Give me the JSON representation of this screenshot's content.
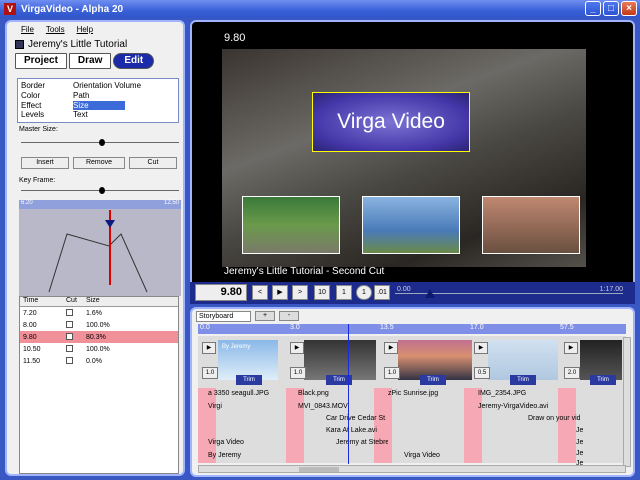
{
  "window": {
    "title": "VirgaVideo - Alpha 20",
    "icon_letter": "V",
    "buttons": [
      "_",
      "□",
      "×"
    ]
  },
  "menu": {
    "items": [
      "File",
      "Tools",
      "Help"
    ]
  },
  "document": {
    "title": "Jeremy's Little Tutorial"
  },
  "mode_tabs": [
    {
      "label": "Project"
    },
    {
      "label": "Draw"
    },
    {
      "label": "Edit",
      "active": true
    }
  ],
  "properties": {
    "col1": [
      "Border",
      "Color",
      "Effect",
      "Levels"
    ],
    "col2": [
      "Orientation  Volume",
      "Path",
      "Size",
      "Text"
    ],
    "selected": "Size"
  },
  "master_size": {
    "label": "Master Size:",
    "value": 0.5
  },
  "actions": [
    "Insert",
    "Remove",
    "Cut"
  ],
  "keyframe": {
    "label": "Key Frame:",
    "ruler_start": "6.20",
    "ruler_end": "12.50"
  },
  "kf_table": {
    "headers": [
      "Time",
      "Cut",
      "Size"
    ],
    "rows": [
      [
        "7.20",
        "",
        "1.6%"
      ],
      [
        "8.00",
        "",
        "100.0%"
      ],
      [
        "9.80",
        "",
        "80.3%"
      ],
      [
        "10.50",
        "",
        "100.0%"
      ],
      [
        "11.50",
        "",
        "0.0%"
      ]
    ],
    "selected_row": 2
  },
  "preview": {
    "time": "9.80",
    "overlay_title": "Virga Video",
    "caption": "Jeremy's Little Tutorial - Second Cut"
  },
  "transport": {
    "current": "9.80",
    "buttons": [
      "<",
      "▶",
      ">",
      "10",
      "1",
      "1",
      ".01"
    ],
    "scrub_start": "0.00",
    "scrub_end": "1:17.00"
  },
  "storyboard": {
    "select": "Storyboard",
    "buttons": [
      "+",
      "-"
    ],
    "ruler": [
      "0.0",
      "3.0",
      "13.5",
      "17.0",
      "57.5"
    ],
    "clips": [
      {
        "num": "1.0",
        "trim": "Trim",
        "caption": "By Jeremy"
      },
      {
        "num": "1.0",
        "trim": "Trim"
      },
      {
        "num": "1.0",
        "trim": "Trim"
      },
      {
        "num": "0.5",
        "trim": "Trim"
      },
      {
        "num": "2.0",
        "trim": "Trim"
      }
    ],
    "lanes": [
      "a 3350 seagull.JPG",
      "Virgi",
      "Virga Video",
      "By Jeremy",
      "Black.png",
      "MVI_0843.MOV",
      "Car Drive Cedar St.avi",
      "Kara At Lake.avi",
      "Jeremy at Stebre",
      "zPic Sunrise.jpg",
      "Virga Video",
      "IMG_2354.JPG",
      "Jeremy-VirgaVideo.avi",
      "Draw on your video",
      "Je",
      "Je",
      "Je",
      "Je"
    ]
  }
}
